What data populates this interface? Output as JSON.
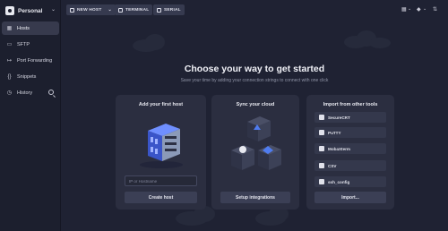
{
  "sidebar": {
    "vault_label": "Personal",
    "items": [
      {
        "label": "Hosts",
        "icon": "hosts-icon",
        "active": true
      },
      {
        "label": "SFTP",
        "icon": "folder-icon",
        "active": false
      },
      {
        "label": "Port Forwarding",
        "icon": "port-forwarding-icon",
        "active": false
      },
      {
        "label": "Snippets",
        "icon": "snippets-icon",
        "active": false
      },
      {
        "label": "History",
        "icon": "history-icon",
        "active": false
      }
    ]
  },
  "toolbar": {
    "new_host": "NEW HOST",
    "terminal": "TERMINAL",
    "serial": "SERIAL"
  },
  "main": {
    "headline": "Choose your way to get started",
    "subline": "Save your time by adding your connection strings to connect with one click",
    "cards": {
      "add_host": {
        "title": "Add your first host",
        "input_placeholder": "IP or Hostname",
        "button": "Create host"
      },
      "sync": {
        "title": "Sync your cloud",
        "button": "Setup integrations"
      },
      "import": {
        "title": "Import from other tools",
        "items": [
          "SecureCRT",
          "PuTTY",
          "MobaXterm",
          "CSV",
          "ssh_config"
        ],
        "button": "Import..."
      }
    }
  },
  "colors": {
    "background": "#1f2233",
    "sidebar": "#1c1f2e",
    "card": "#2b2e40",
    "button": "#3b3f55",
    "accent_blue": "#4f7cf0"
  }
}
